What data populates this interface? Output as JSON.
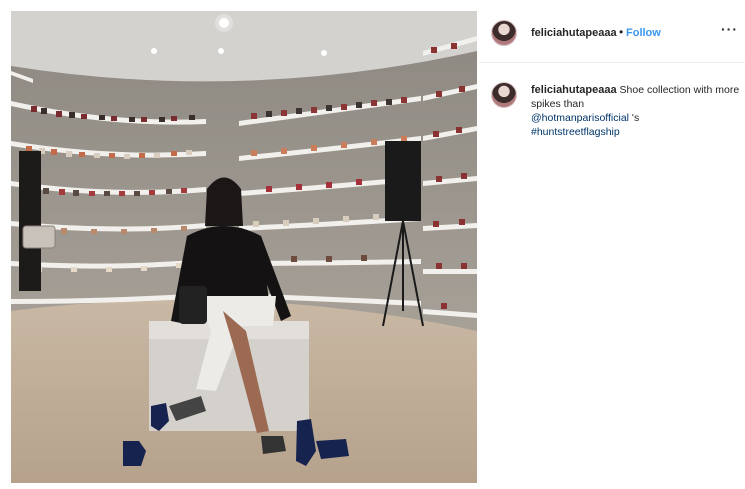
{
  "post": {
    "username": "feliciahutapeaaa",
    "separator": "•",
    "follow_label": "Follow",
    "more_label": "···",
    "image_icon": "photo-image",
    "caption": {
      "username": "feliciahutapeaaa",
      "text_before": "Shoe collection with more spikes than",
      "mention": "@hotmanparisofficial",
      "text_mid": " 's",
      "hashtag": "#huntstreetflagship"
    }
  },
  "colors": {
    "link_blue": "#3897f0",
    "tag_navy": "#003569",
    "divider": "#efefef"
  }
}
